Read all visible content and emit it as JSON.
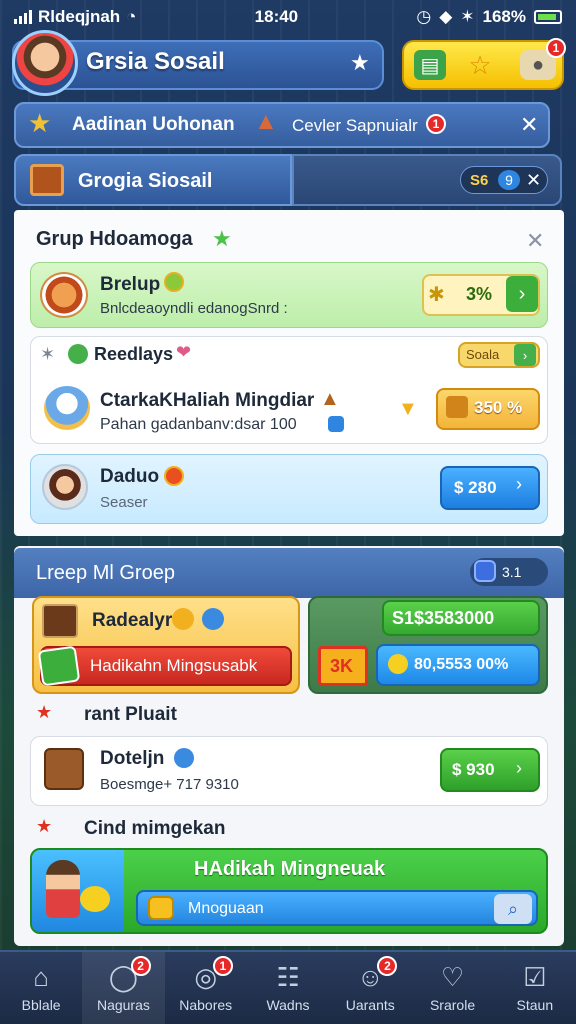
{
  "status_bar": {
    "carrier": "Rldeqjnah",
    "time": "18:40",
    "battery": "168%"
  },
  "header": {
    "title": "Grsia Sosail"
  },
  "top_right": {
    "notif_count": "1"
  },
  "banner1": {
    "left_text": "Aadinan Uohonan",
    "right_text": "Cevler Sapnuialr",
    "notif": "1"
  },
  "banner2": {
    "title": "Grogia Siosail",
    "num1": "S6",
    "num2": "9"
  },
  "group": {
    "title": "Grup Hdoamoga",
    "card1": {
      "title": "Brelup",
      "subtitle": "Bnlcdeaoyndli edanogSnrd  :",
      "btn_value": "3%"
    },
    "card2": {
      "label": "Reedlays",
      "badge": "Soala",
      "title": "CtarkaKHaliah Mingdiar",
      "subtitle": "Pahan gadanbanv:dsar 100",
      "btn_value": "350 %"
    },
    "card3": {
      "title": "Daduo",
      "subtitle": "Seaser",
      "btn_value": "$ 280"
    }
  },
  "lower": {
    "title": "Lreep Ml Groep",
    "pill_num": "3.1",
    "orange_card": {
      "title": "Radealyr",
      "red_label": "Hadikahn Mingsusabk"
    },
    "green_card": {
      "top_value": "S1$3583000",
      "square_label": "3K",
      "bottom_value": "80,5553 00%"
    },
    "section1": "rant Pluait",
    "card_d": {
      "title": "Doteljn",
      "subtitle": "Boesmge+ 717 9310",
      "btn_value": "$ 930"
    },
    "section2": "Cind mimgekan",
    "big_card": {
      "title": "HAdikah Mingneuak",
      "search_text": "Mnoguaan"
    }
  },
  "nav": [
    {
      "label": "Bblale",
      "icon": "home-icon",
      "notif": ""
    },
    {
      "label": "Naguras",
      "icon": "chat-icon",
      "notif": "2"
    },
    {
      "label": "Nabores",
      "icon": "gamepad-icon",
      "notif": "1"
    },
    {
      "label": "Wadns",
      "icon": "grid-icon",
      "notif": ""
    },
    {
      "label": "Uarants",
      "icon": "group-icon",
      "notif": "2"
    },
    {
      "label": "Srarole",
      "icon": "heart-icon",
      "notif": ""
    },
    {
      "label": "Staun",
      "icon": "checklist-icon",
      "notif": ""
    }
  ],
  "colors": {
    "accent_blue": "#2f86e0",
    "accent_green": "#3cae3c",
    "accent_yellow": "#f5c000",
    "alert_red": "#e52828"
  }
}
